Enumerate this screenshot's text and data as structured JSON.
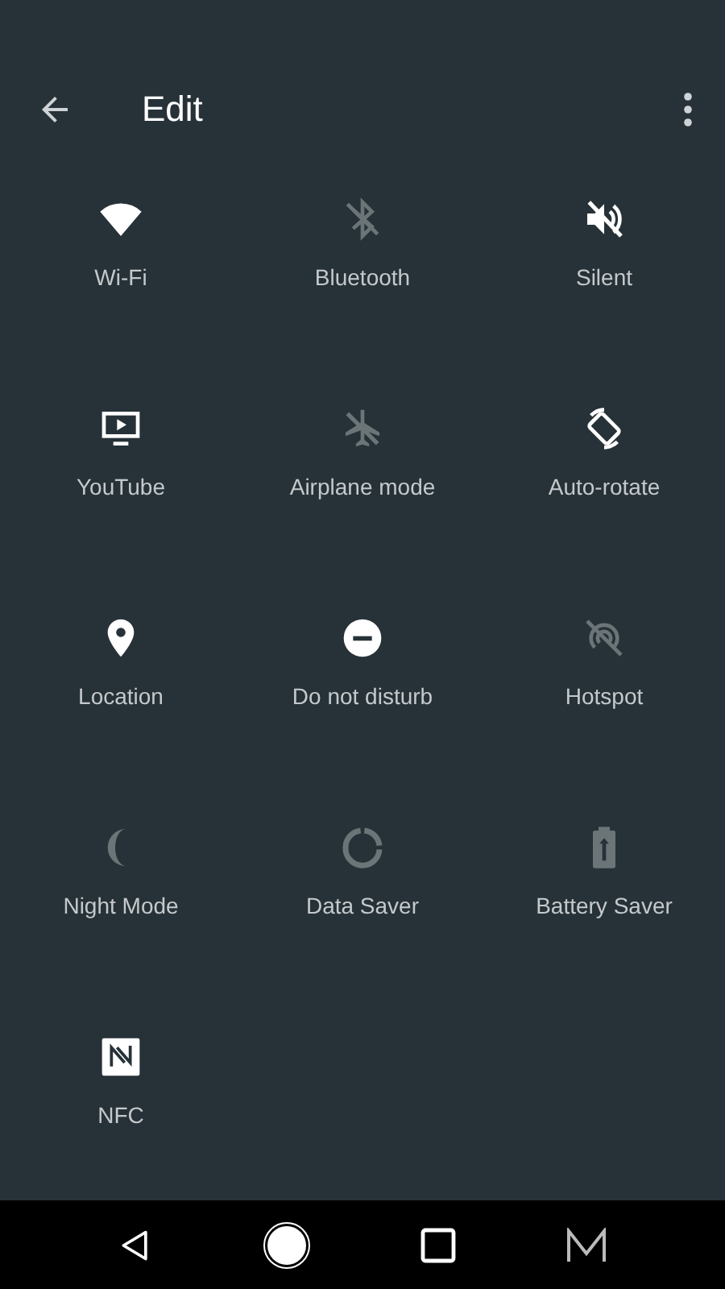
{
  "toolbar": {
    "title": "Edit"
  },
  "tiles": [
    {
      "kind": "wifi",
      "label": "Wi-Fi",
      "on": true
    },
    {
      "kind": "bluetooth",
      "label": "Bluetooth",
      "on": false
    },
    {
      "kind": "silent",
      "label": "Silent",
      "on": true
    },
    {
      "kind": "cast",
      "label": "YouTube",
      "on": true
    },
    {
      "kind": "airplane",
      "label": "Airplane mode",
      "on": false
    },
    {
      "kind": "rotate",
      "label": "Auto-rotate",
      "on": true
    },
    {
      "kind": "location",
      "label": "Location",
      "on": true
    },
    {
      "kind": "dnd",
      "label": "Do not disturb",
      "on": true
    },
    {
      "kind": "hotspot",
      "label": "Hotspot",
      "on": false
    },
    {
      "kind": "night",
      "label": "Night Mode",
      "on": false
    },
    {
      "kind": "datasaver",
      "label": "Data Saver",
      "on": false
    },
    {
      "kind": "battery",
      "label": "Battery Saver",
      "on": false
    },
    {
      "kind": "nfc",
      "label": "NFC",
      "on": true
    }
  ]
}
